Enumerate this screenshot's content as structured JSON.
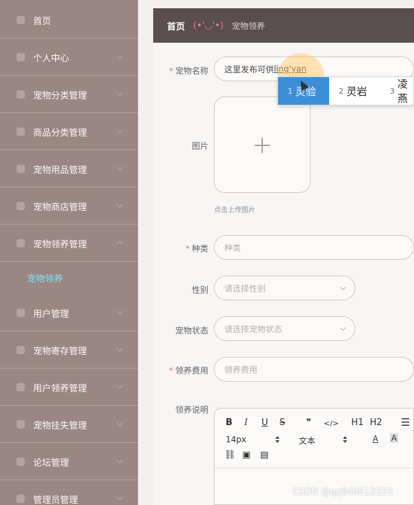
{
  "sidebar": {
    "items": [
      {
        "label": "首页",
        "icon": "home-icon"
      },
      {
        "label": "个人中心",
        "icon": "user-icon"
      },
      {
        "label": "宠物分类管理",
        "icon": "folder-icon"
      },
      {
        "label": "商品分类管理",
        "icon": "list-icon"
      },
      {
        "label": "宠物用品管理",
        "icon": "box-icon"
      },
      {
        "label": "宠物商店管理",
        "icon": "shop-icon"
      },
      {
        "label": "宠物领养管理",
        "icon": "heart-icon"
      },
      {
        "label": "用户管理",
        "icon": "send-icon"
      },
      {
        "label": "宠物寄存管理",
        "icon": "flag-icon"
      },
      {
        "label": "用户领养管理",
        "icon": "clock-icon"
      },
      {
        "label": "宠物挂失管理",
        "icon": "alert-icon"
      },
      {
        "label": "论坛管理",
        "icon": "menu-icon"
      },
      {
        "label": "管理员管理",
        "icon": "admin-icon"
      }
    ],
    "active_sub": "宠物领养",
    "accent_color": "#7fe3f5",
    "bg_color": "#9a8682"
  },
  "breadcrumb": {
    "home": "首页",
    "emoticon": "(•'◡'•)",
    "page": "宠物领养"
  },
  "form": {
    "name_label": "宠物名称",
    "name_value_prefix": "这里发布可供",
    "name_value_pinyin": "ling'yan",
    "image_label": "图片",
    "image_hint": "点击上传图片",
    "species_label": "种类",
    "species_placeholder": "种类",
    "gender_label": "性别",
    "gender_placeholder": "请选择性别",
    "status_label": "宠物状态",
    "status_placeholder": "请选择宠物状态",
    "fee_label": "领养费用",
    "fee_placeholder": "领养费用",
    "desc_label": "领养说明"
  },
  "ime": {
    "candidates": [
      {
        "num": "1",
        "text": "灵验"
      },
      {
        "num": "2",
        "text": "灵岩"
      },
      {
        "num": "3",
        "text": "凌燕"
      }
    ],
    "selected_index": 0
  },
  "editor": {
    "bold": "B",
    "italic": "I",
    "underline": "U",
    "strike": "S",
    "quote": "❞",
    "code": "</>",
    "h1": "H1",
    "h2": "H2",
    "font_size": "14px",
    "font_style": "文本",
    "font_color": "A",
    "bg_color": "A"
  },
  "watermark": "CSDN @qq840612233"
}
